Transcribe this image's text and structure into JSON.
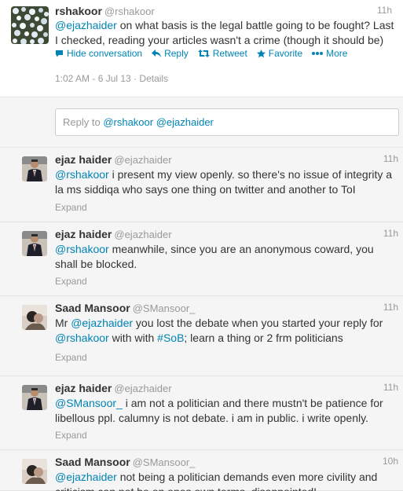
{
  "main_tweet": {
    "fullname": "rshakoor",
    "username": "@rshakoor",
    "time": "11h",
    "mention": "@ejazhaider",
    "text": " on what basis is the legal battle going to be fought? Last I checked, reading your articles wasn't a crime (though it should be)",
    "actions": {
      "hide": "Hide conversation",
      "reply": "Reply",
      "retweet": "Retweet",
      "favorite": "Favorite",
      "more": "More"
    },
    "timestamp": "1:02 AM - 6 Jul 13",
    "separator": " · ",
    "details": "Details"
  },
  "reply_box": {
    "prefix": "Reply to ",
    "mentions": "@rshakoor @ejazhaider"
  },
  "tweets": [
    {
      "fullname": "ejaz haider",
      "username": "@ejazhaider",
      "time": "11h",
      "parts": [
        {
          "text": "@rshakoor",
          "link": true
        },
        {
          "text": " i present my view openly. so there's no issue of integrity a la ms siddiqa who says one thing on twitter and another to ToI",
          "link": false
        }
      ],
      "expand": "Expand"
    },
    {
      "fullname": "ejaz haider",
      "username": "@ejazhaider",
      "time": "11h",
      "parts": [
        {
          "text": "@rshakoor",
          "link": true
        },
        {
          "text": " meanwhile, since you are an anonymous coward, you shall be blocked.",
          "link": false
        }
      ],
      "expand": "Expand"
    },
    {
      "fullname": "Saad Mansoor",
      "username": "@SMansoor_",
      "time": "11h",
      "parts": [
        {
          "text": "Mr ",
          "link": false
        },
        {
          "text": "@ejazhaider",
          "link": true
        },
        {
          "text": " you lost the debate when you started your reply for ",
          "link": false
        },
        {
          "text": "@rshakoor",
          "link": true
        },
        {
          "text": " with with ",
          "link": false
        },
        {
          "text": "#SoB",
          "link": true
        },
        {
          "text": "; learn a thing or 2 frm politicians",
          "link": false
        }
      ],
      "expand": "Expand"
    },
    {
      "fullname": "ejaz haider",
      "username": "@ejazhaider",
      "time": "11h",
      "parts": [
        {
          "text": "@SMansoor_",
          "link": true
        },
        {
          "text": " i am not a politician and there mustn't be patience for libellous ppl. calumny is not debate. i am in public. i write openly.",
          "link": false
        }
      ],
      "expand": "Expand"
    },
    {
      "fullname": "Saad Mansoor",
      "username": "@SMansoor_",
      "time": "10h",
      "parts": [
        {
          "text": "@ejazhaider",
          "link": true
        },
        {
          "text": " not being a politician demands even more civility and criticism can not be on ones own terms, disappointed!",
          "link": false
        }
      ],
      "expand": ""
    }
  ],
  "colors": {
    "link": "#0084b4",
    "muted": "#999999",
    "text": "#333333",
    "background_gray": "#f5f5f5"
  },
  "icons": {
    "hide": "hide-conversation-icon",
    "reply": "reply-arrow-icon",
    "retweet": "retweet-icon",
    "favorite": "star-icon",
    "more": "more-dots-icon"
  }
}
